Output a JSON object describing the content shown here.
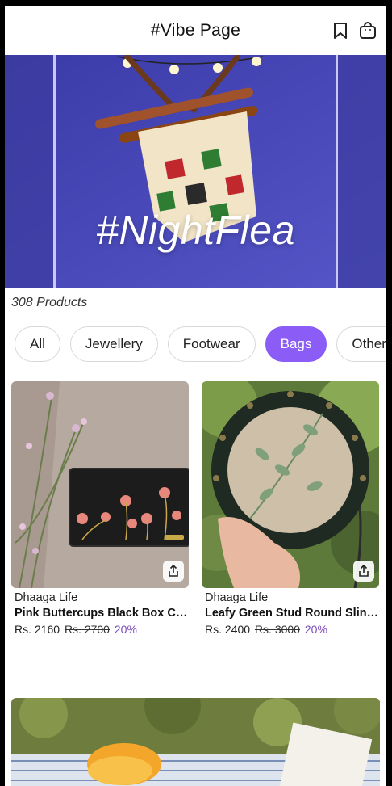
{
  "header": {
    "title": "#Vibe Page",
    "icons": [
      "bookmark-icon",
      "shopping-bag-icon"
    ]
  },
  "banner": {
    "text": "#NightFlea"
  },
  "product_count": "308 Products",
  "filters": {
    "chips": [
      {
        "label": "All",
        "active": false
      },
      {
        "label": "Jewellery",
        "active": false
      },
      {
        "label": "Footwear",
        "active": false
      },
      {
        "label": "Bags",
        "active": true
      },
      {
        "label": "Others",
        "active": false
      }
    ],
    "accent": "#8b5cf6"
  },
  "products": [
    {
      "brand": "Dhaaga Life",
      "name": "Pink Buttercups Black Box Clutch",
      "price": "Rs. 2160",
      "mrp": "Rs. 2700",
      "discount": "20%"
    },
    {
      "brand": "Dhaaga Life",
      "name": "Leafy Green Stud Round Sling Bag",
      "price": "Rs. 2400",
      "mrp": "Rs. 3000",
      "discount": "20%"
    }
  ]
}
